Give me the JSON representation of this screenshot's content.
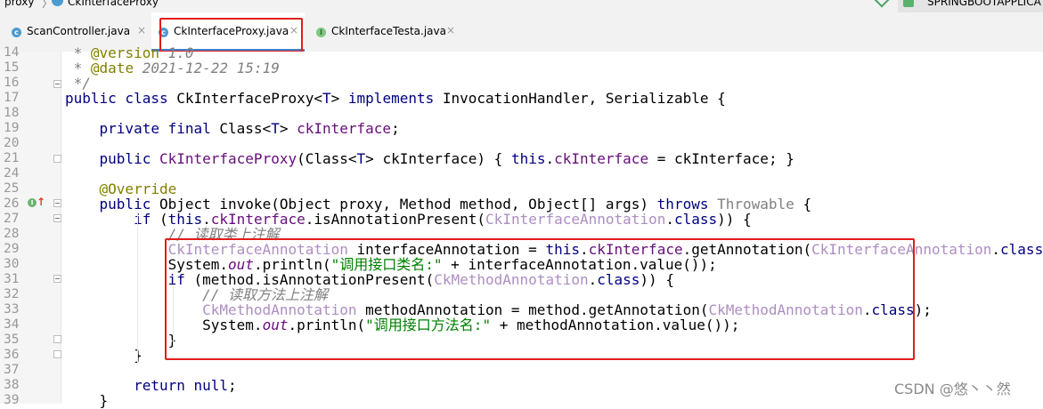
{
  "breadcrumb": {
    "items": [
      "proxy",
      "CkInterfaceProxy"
    ],
    "separator": "〉"
  },
  "run_config": {
    "label": "SPRINGBOOTAPPLICA"
  },
  "tabs": [
    {
      "label": "ScanController.java",
      "icon": "class-icon",
      "active": false
    },
    {
      "label": "CkInterfaceProxy.java",
      "icon": "class-icon",
      "active": true
    },
    {
      "label": "CkInterfaceTesta.java",
      "icon": "interface-icon",
      "active": false
    }
  ],
  "tab_close_glyph": "×",
  "gutter": {
    "impl_marker": "I",
    "impl_arrow": "↑"
  },
  "editor": {
    "lines": [
      {
        "n": "14",
        "parts": [
          [
            "cm",
            " * "
          ],
          [
            "an",
            "@version"
          ],
          [
            "cm",
            " 1.0"
          ]
        ]
      },
      {
        "n": "15",
        "parts": [
          [
            "cm",
            " * "
          ],
          [
            "an",
            "@date"
          ],
          [
            "cm",
            " 2021-12-22 15:19"
          ]
        ]
      },
      {
        "n": "16",
        "parts": [
          [
            "cm",
            " */"
          ]
        ]
      },
      {
        "n": "17",
        "parts": [
          [
            "kw",
            "public class "
          ],
          [
            "",
            "CkInterfaceProxy<"
          ],
          [
            "kw",
            "T"
          ],
          [
            "",
            "> "
          ],
          [
            "kw",
            "implements "
          ],
          [
            "",
            "InvocationHandler, Serializable {"
          ]
        ]
      },
      {
        "n": "18",
        "parts": []
      },
      {
        "n": "19",
        "parts": [
          [
            "",
            "    "
          ],
          [
            "kw",
            "private final "
          ],
          [
            "",
            "Class<"
          ],
          [
            "kw",
            "T"
          ],
          [
            "",
            "> "
          ],
          [
            "fd",
            "ckInterface"
          ],
          [
            "",
            ";"
          ]
        ]
      },
      {
        "n": "20",
        "parts": []
      },
      {
        "n": "21",
        "parts": [
          [
            "",
            "    "
          ],
          [
            "kw",
            "public "
          ],
          [
            "fd",
            "CkInterfaceProxy"
          ],
          [
            "",
            "(Class<"
          ],
          [
            "kw",
            "T"
          ],
          [
            "",
            "> ckInterface) { "
          ],
          [
            "kw",
            "this"
          ],
          [
            "",
            "."
          ],
          [
            "fd",
            "ckInterface"
          ],
          [
            "",
            " = ckInterface; }"
          ]
        ]
      },
      {
        "n": "24",
        "parts": []
      },
      {
        "n": "25",
        "parts": [
          [
            "",
            "    "
          ],
          [
            "an",
            "@Override"
          ]
        ]
      },
      {
        "n": "26",
        "parts": [
          [
            "",
            "    "
          ],
          [
            "kw",
            "public "
          ],
          [
            "",
            "Object invoke(Object proxy, Method method, Object[] args) "
          ],
          [
            "kw",
            "throws "
          ],
          [
            "gr",
            "Throwable"
          ],
          [
            "",
            " {"
          ]
        ]
      },
      {
        "n": "27",
        "parts": [
          [
            "",
            "        "
          ],
          [
            "kw",
            "if "
          ],
          [
            "",
            "("
          ],
          [
            "kw",
            "this"
          ],
          [
            "",
            "."
          ],
          [
            "fd",
            "ckInterface"
          ],
          [
            "",
            ".isAnnotationPresent("
          ],
          [
            "cl",
            "CkInterfaceAnnotation"
          ],
          [
            "",
            "."
          ],
          [
            "kw",
            "class"
          ],
          [
            "",
            ")) {"
          ]
        ]
      },
      {
        "n": "28",
        "parts": [
          [
            "",
            "            "
          ],
          [
            "cm",
            "// 读取类上注解"
          ]
        ]
      },
      {
        "n": "29",
        "parts": [
          [
            "",
            "            "
          ],
          [
            "cl",
            "CkInterfaceAnnotation"
          ],
          [
            "",
            " interfaceAnnotation = "
          ],
          [
            "kw",
            "this"
          ],
          [
            "",
            "."
          ],
          [
            "fd",
            "ckInterface"
          ],
          [
            "",
            ".getAnnotation("
          ],
          [
            "cl",
            "CkInterfaceAnnotation"
          ],
          [
            "",
            "."
          ],
          [
            "kw",
            "class"
          ],
          [
            "",
            ");"
          ]
        ]
      },
      {
        "n": "30",
        "parts": [
          [
            "",
            "            System."
          ],
          [
            "sf",
            "out"
          ],
          [
            "",
            ".println("
          ],
          [
            "st",
            "\"调用接口类名:\""
          ],
          [
            "",
            " + interfaceAnnotation.value());"
          ]
        ]
      },
      {
        "n": "31",
        "parts": [
          [
            "",
            "            "
          ],
          [
            "kw",
            "if "
          ],
          [
            "",
            "(method.isAnnotationPresent("
          ],
          [
            "cl",
            "CkMethodAnnotation"
          ],
          [
            "",
            "."
          ],
          [
            "kw",
            "class"
          ],
          [
            "",
            ")) {"
          ]
        ]
      },
      {
        "n": "32",
        "parts": [
          [
            "",
            "                "
          ],
          [
            "cm",
            "// 读取方法上注解"
          ]
        ]
      },
      {
        "n": "33",
        "parts": [
          [
            "",
            "                "
          ],
          [
            "cl",
            "CkMethodAnnotation"
          ],
          [
            "",
            " methodAnnotation = method.getAnnotation("
          ],
          [
            "cl",
            "CkMethodAnnotation"
          ],
          [
            "",
            "."
          ],
          [
            "kw",
            "class"
          ],
          [
            "",
            ");"
          ]
        ]
      },
      {
        "n": "34",
        "parts": [
          [
            "",
            "                System."
          ],
          [
            "sf",
            "out"
          ],
          [
            "",
            ".println("
          ],
          [
            "st",
            "\"调用接口方法名:\""
          ],
          [
            "",
            " + methodAnnotation.value());"
          ]
        ]
      },
      {
        "n": "35",
        "parts": [
          [
            "",
            "            }"
          ]
        ]
      },
      {
        "n": "36",
        "parts": [
          [
            "",
            "        }"
          ]
        ]
      },
      {
        "n": "37",
        "parts": []
      },
      {
        "n": "38",
        "parts": [
          [
            "",
            "        "
          ],
          [
            "kw",
            "return null"
          ],
          [
            "",
            ";"
          ]
        ]
      },
      {
        "n": "39",
        "parts": [
          [
            "",
            "    }"
          ]
        ]
      }
    ]
  },
  "watermark": "CSDN @悠丶丶然",
  "colors": {
    "keyword": "#000080",
    "comment": "#808080",
    "annotation": "#808000",
    "field": "#660e7a",
    "string": "#008000",
    "highlight_box": "#e21c1c",
    "active_tab_underline": "#4083c9"
  }
}
